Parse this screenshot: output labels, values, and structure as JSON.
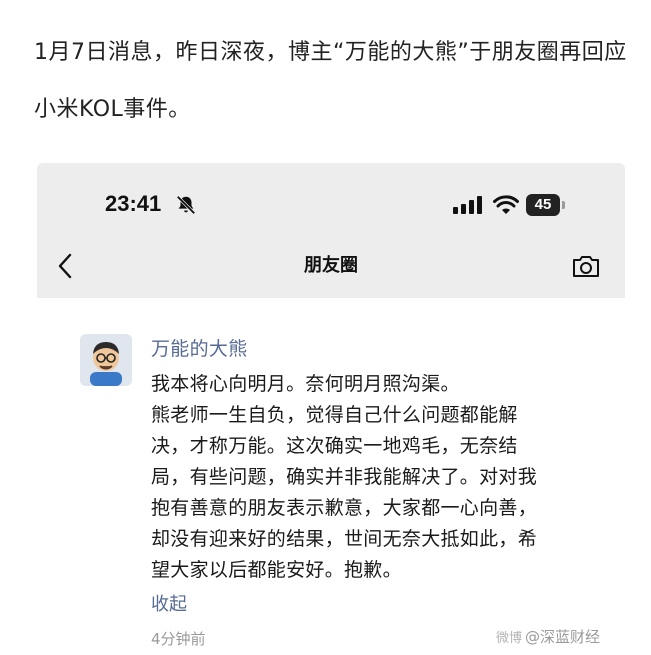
{
  "article": {
    "text": "1月7日消息，昨日深夜，博主“万能的大熊”于朋友圈再回应小米KOL事件。"
  },
  "status_bar": {
    "time": "23:41",
    "battery_level": "45",
    "icons": [
      "bell-slash-icon",
      "cellular-signal-icon",
      "wifi-icon",
      "battery-icon"
    ]
  },
  "nav": {
    "title": "朋友圈",
    "back_icon": "chevron-left-icon",
    "camera_icon": "camera-icon"
  },
  "post": {
    "username": "万能的大熊",
    "content": "我本将心向明月。奈何明月照沟渠。\n熊老师一生自负，觉得自己什么问题都能解决，才称万能。这次确实一地鸡毛，无奈结局，有些问题，确实并非我能解决了。对对我抱有善意的朋友表示歉意，大家都一心向善，却没有迎来好的结果，世间无奈大抵如此，希望大家以后都能安好。抱歉。",
    "collapse_label": "收起",
    "timestamp": "4分钟前"
  },
  "watermark": {
    "prefix": "微博",
    "text": "@深蓝财经"
  },
  "colors": {
    "link_blue": "#576b95",
    "header_bg": "#ededed",
    "meta_gray": "#9a9a9a"
  }
}
